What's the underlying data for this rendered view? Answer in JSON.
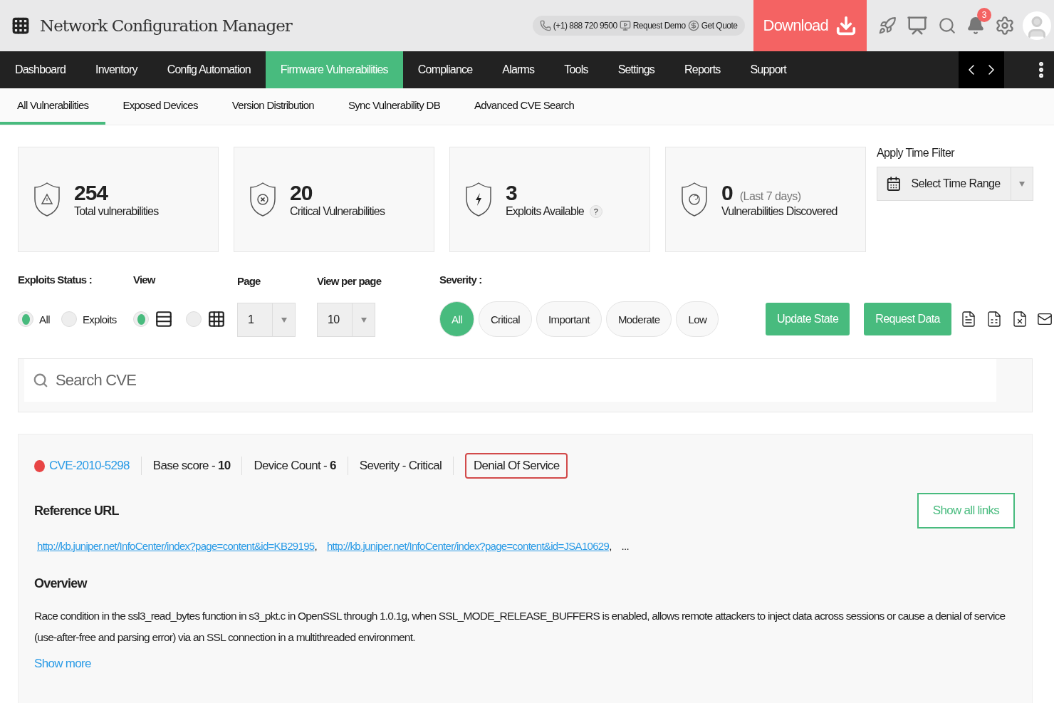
{
  "header": {
    "title": "Network Configuration Manager",
    "phone": "(+1) 888 720 9500",
    "request_demo": "Request Demo",
    "get_quote": "Get Quote",
    "download": "Download",
    "notification_count": "3"
  },
  "main_nav": [
    {
      "label": "Dashboard",
      "selected": false
    },
    {
      "label": "Inventory",
      "selected": false
    },
    {
      "label": "Config Automation",
      "selected": false
    },
    {
      "label": "Firmware Vulnerabilities",
      "selected": true
    },
    {
      "label": "Compliance",
      "selected": false
    },
    {
      "label": "Alarms",
      "selected": false
    },
    {
      "label": "Tools",
      "selected": false
    },
    {
      "label": "Settings",
      "selected": false
    },
    {
      "label": "Reports",
      "selected": false
    },
    {
      "label": "Support",
      "selected": false
    }
  ],
  "sub_tabs": [
    {
      "label": "All Vulnerabilities",
      "selected": true
    },
    {
      "label": "Exposed Devices",
      "selected": false
    },
    {
      "label": "Version Distribution",
      "selected": false
    },
    {
      "label": "Sync Vulnerability DB",
      "selected": false
    },
    {
      "label": "Advanced CVE Search",
      "selected": false
    }
  ],
  "stats": [
    {
      "kind": "warning",
      "value": "254",
      "label": "Total vulnerabilities"
    },
    {
      "kind": "critical",
      "value": "20",
      "label": "Critical Vulnerabilities"
    },
    {
      "kind": "exploit",
      "value": "3",
      "label": "Exploits Available",
      "help": "?"
    },
    {
      "kind": "discovered",
      "value": "0",
      "note": "(Last 7 days)",
      "label": "Vulnerabilities Discovered"
    }
  ],
  "time_filter": {
    "label": "Apply Time Filter",
    "value": "Select Time Range"
  },
  "filters": {
    "exploits_status": {
      "label": "Exploits Status :",
      "options": [
        {
          "label": "All",
          "selected": true
        },
        {
          "label": "Exploits",
          "selected": false
        }
      ]
    },
    "view": {
      "label": "View",
      "options": [
        {
          "kind": "list",
          "selected": true
        },
        {
          "kind": "grid",
          "selected": false
        }
      ]
    },
    "page": {
      "label": "Page",
      "value": "1"
    },
    "per_page": {
      "label": "View per page",
      "value": "10"
    },
    "severity": {
      "label": "Severity :",
      "options": [
        {
          "label": "All",
          "selected": true
        },
        {
          "label": "Critical",
          "selected": false
        },
        {
          "label": "Important",
          "selected": false
        },
        {
          "label": "Moderate",
          "selected": false
        },
        {
          "label": "Low",
          "selected": false
        }
      ]
    },
    "buttons": [
      "Update State",
      "Request Data"
    ]
  },
  "search": {
    "placeholder": "Search CVE"
  },
  "cve": {
    "id": "CVE-2010-5298",
    "color": "#e84545",
    "base_score": "Base score - **10**",
    "device_count": "Device Count - **6**",
    "severity": "Severity - Critical",
    "tag": "Denial Of Service",
    "reference_title": "Reference URL",
    "links": [
      "http://kb.juniper.net/InfoCenter/index?page=content&id=KB29195",
      "http://kb.juniper.net/InfoCenter/index?page=content&id=JSA10629"
    ],
    "separator": ",",
    "more": "...",
    "show_all_links": "Show all links",
    "overview_title": "Overview",
    "overview": "Race condition in the ssl3_read_bytes function in s3_pkt.c in OpenSSL through 1.0.1g, when SSL_MODE_RELEASE_BUFFERS is enabled, allows remote attackers to inject data across sessions or cause a denial of service (use-after-free and parsing error) via an SSL connection in a multithreaded environment.",
    "show_more": "Show more"
  }
}
